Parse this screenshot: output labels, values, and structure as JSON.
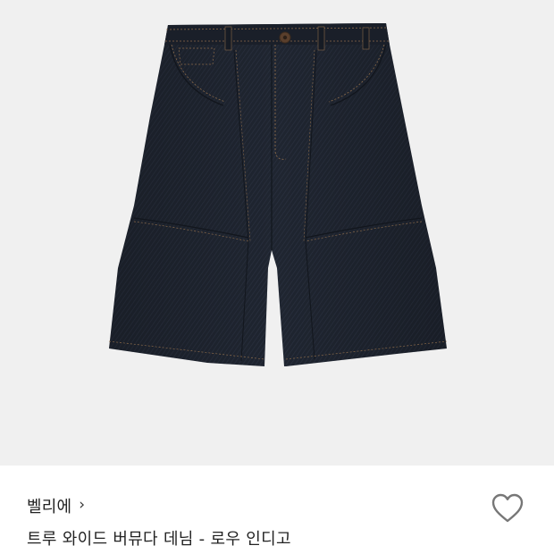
{
  "product": {
    "image_alt": "shorts",
    "brand": "벨리에",
    "brand_chevron": "›",
    "title": "트루 와이드 버뮤다 데님 - 로우 인디고",
    "wishlist_icon": "heart-outline-icon"
  },
  "colors": {
    "background": "#ffffff",
    "photo_background": "#f0f0f0",
    "denim": "#1f2530",
    "stitch": "#8a6a4a",
    "text": "#222222",
    "icon": "#777777"
  }
}
